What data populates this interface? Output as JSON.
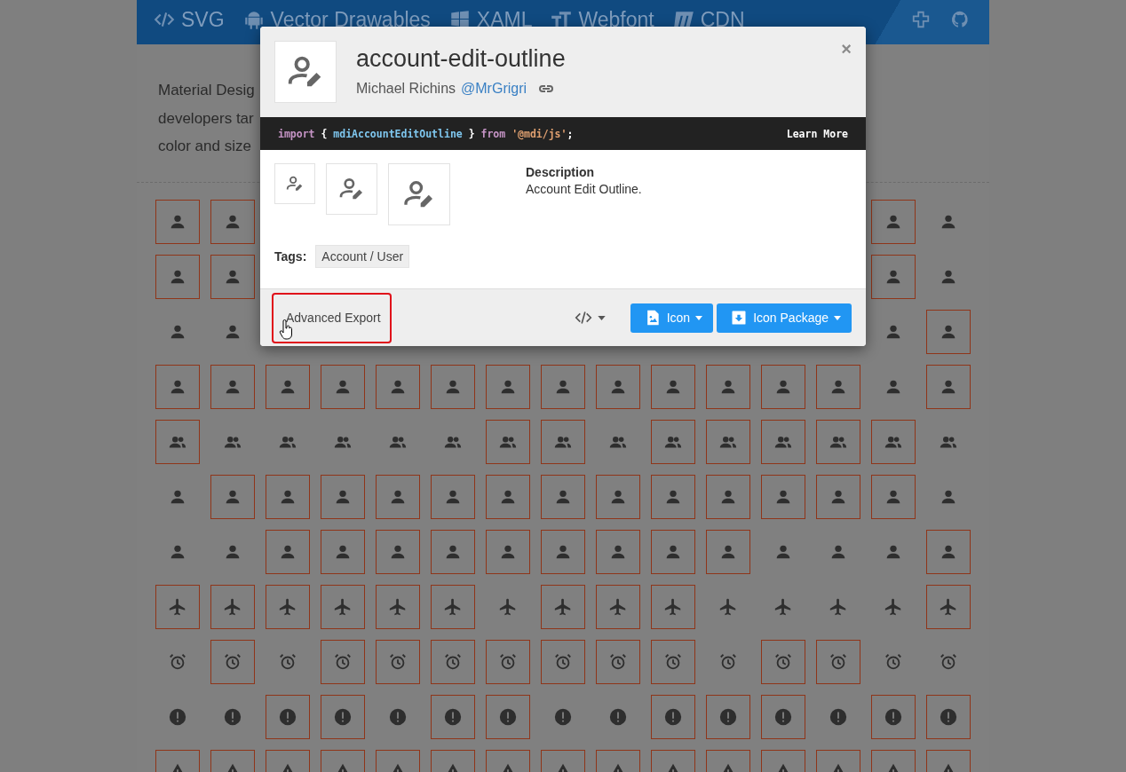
{
  "header": {
    "nav": [
      {
        "label": "SVG",
        "kind": "svg"
      },
      {
        "label": "Vector Drawables",
        "kind": "android"
      },
      {
        "label": "XAML",
        "kind": "windows"
      },
      {
        "label": "Webfont",
        "kind": "font"
      },
      {
        "label": "CDN",
        "kind": "cdn"
      }
    ]
  },
  "intro": {
    "lines": [
      "Material Desig",
      "developers tar",
      "color and size"
    ]
  },
  "grid": {
    "rows": [
      {
        "tiles": [
          {
            "outlined": true
          },
          {
            "outlined": true
          },
          {
            "outlined": true
          },
          {
            "outlined": false
          }
        ]
      },
      {
        "tiles": [
          {
            "outlined": true
          },
          {
            "outlined": true
          },
          {
            "outlined": true
          },
          {
            "outlined": false
          }
        ]
      },
      {
        "tiles": [
          {
            "outlined": false
          },
          {
            "outlined": false
          },
          {
            "outlined": false
          },
          {
            "outlined": true
          }
        ]
      },
      {
        "tiles": [
          {
            "outlined": true
          },
          {
            "outlined": true
          },
          {
            "outlined": true
          },
          {
            "outlined": true
          },
          {
            "outlined": true
          },
          {
            "outlined": true
          },
          {
            "outlined": true
          },
          {
            "outlined": true
          },
          {
            "outlined": true
          },
          {
            "outlined": true
          },
          {
            "outlined": true
          },
          {
            "outlined": true
          },
          {
            "outlined": true
          },
          {
            "outlined": false
          },
          {
            "outlined": true
          }
        ]
      },
      {
        "tiles": [
          {
            "outlined": true
          },
          {
            "outlined": false
          },
          {
            "outlined": false
          },
          {
            "outlined": false
          },
          {
            "outlined": false
          },
          {
            "outlined": false
          },
          {
            "outlined": true
          },
          {
            "outlined": true
          },
          {
            "outlined": false
          },
          {
            "outlined": true
          },
          {
            "outlined": true
          },
          {
            "outlined": true
          },
          {
            "outlined": true
          },
          {
            "outlined": true
          },
          {
            "outlined": false
          }
        ]
      },
      {
        "tiles": [
          {
            "outlined": false
          },
          {
            "outlined": true
          },
          {
            "outlined": true
          },
          {
            "outlined": true
          },
          {
            "outlined": true
          },
          {
            "outlined": true
          },
          {
            "outlined": true
          },
          {
            "outlined": true
          },
          {
            "outlined": true
          },
          {
            "outlined": true
          },
          {
            "outlined": true
          },
          {
            "outlined": true
          },
          {
            "outlined": true
          },
          {
            "outlined": true
          },
          {
            "outlined": false
          }
        ]
      },
      {
        "tiles": [
          {
            "outlined": false
          },
          {
            "outlined": false
          },
          {
            "outlined": true
          },
          {
            "outlined": true
          },
          {
            "outlined": true
          },
          {
            "outlined": true
          },
          {
            "outlined": true
          },
          {
            "outlined": true
          },
          {
            "outlined": true
          },
          {
            "outlined": true
          },
          {
            "outlined": true
          },
          {
            "outlined": false
          },
          {
            "outlined": false
          },
          {
            "outlined": false
          },
          {
            "outlined": true
          }
        ]
      },
      {
        "tiles": [
          {
            "outlined": true
          },
          {
            "outlined": true
          },
          {
            "outlined": true
          },
          {
            "outlined": true
          },
          {
            "outlined": true
          },
          {
            "outlined": true
          },
          {
            "outlined": false
          },
          {
            "outlined": true
          },
          {
            "outlined": true
          },
          {
            "outlined": true
          },
          {
            "outlined": false
          },
          {
            "outlined": false
          },
          {
            "outlined": false
          },
          {
            "outlined": false
          },
          {
            "outlined": true
          }
        ]
      },
      {
        "tiles": [
          {
            "outlined": false
          },
          {
            "outlined": true
          },
          {
            "outlined": false
          },
          {
            "outlined": true
          },
          {
            "outlined": true
          },
          {
            "outlined": true
          },
          {
            "outlined": true
          },
          {
            "outlined": true
          },
          {
            "outlined": true
          },
          {
            "outlined": true
          },
          {
            "outlined": false
          },
          {
            "outlined": true
          },
          {
            "outlined": true
          },
          {
            "outlined": false
          },
          {
            "outlined": false
          }
        ]
      },
      {
        "tiles": [
          {
            "outlined": false
          },
          {
            "outlined": false
          },
          {
            "outlined": true
          },
          {
            "outlined": true
          },
          {
            "outlined": false
          },
          {
            "outlined": true
          },
          {
            "outlined": true
          },
          {
            "outlined": false
          },
          {
            "outlined": false
          },
          {
            "outlined": true
          },
          {
            "outlined": true
          },
          {
            "outlined": true
          },
          {
            "outlined": false
          },
          {
            "outlined": true
          },
          {
            "outlined": true
          }
        ]
      },
      {
        "tiles": [
          {
            "outlined": true
          },
          {
            "outlined": true
          },
          {
            "outlined": true
          },
          {
            "outlined": true
          },
          {
            "outlined": true
          },
          {
            "outlined": true
          },
          {
            "outlined": true
          },
          {
            "outlined": true
          },
          {
            "outlined": true
          },
          {
            "outlined": true
          },
          {
            "outlined": true
          },
          {
            "outlined": true
          },
          {
            "outlined": true
          },
          {
            "outlined": true
          },
          {
            "outlined": true
          }
        ]
      }
    ]
  },
  "modal": {
    "title": "account-edit-outline",
    "author": "Michael Richins",
    "author_link": "@MrGrigri",
    "close": "×",
    "code": [
      {
        "text": "import",
        "kind": "keyword"
      },
      {
        "text": " { ",
        "kind": "plain"
      },
      {
        "text": "mdiAccountEditOutline",
        "kind": "name"
      },
      {
        "text": " } ",
        "kind": "plain"
      },
      {
        "text": "from ",
        "kind": "keyword"
      },
      {
        "text": "'@mdi/js'",
        "kind": "string"
      },
      {
        "text": ";",
        "kind": "plain"
      }
    ],
    "learn_more": "Learn More",
    "description_heading": "Description",
    "description": "Account Edit Outline.",
    "tags_label": "Tags:",
    "tags": [
      "Account / User"
    ],
    "advanced_export": {
      "label": "Advanced Export",
      "highlighted": true
    },
    "buttons": [
      {
        "label": "Icon",
        "kind": "image"
      },
      {
        "label": "Icon Package",
        "kind": "package"
      }
    ]
  }
}
